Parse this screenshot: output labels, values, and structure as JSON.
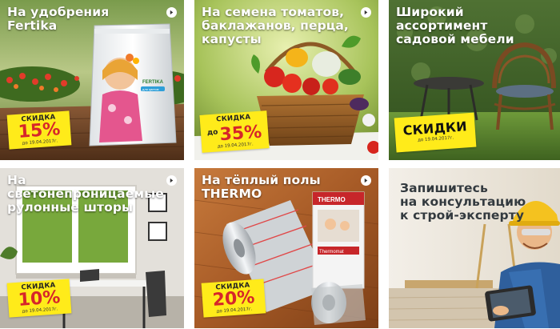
{
  "tiles": [
    {
      "id": "fertilizer",
      "title": "На удобрения\nFertika",
      "product_brand": "FERTIKA",
      "product_text": "для цветов",
      "badge": {
        "label": "СКИДКА",
        "percent": "15%",
        "prefix": "",
        "date": "до 19.04.2017г."
      }
    },
    {
      "id": "seeds",
      "title": "На семена томатов,\nбаклажанов, перца,\nкапусты",
      "badge": {
        "label": "СКИДКА",
        "percent": "35%",
        "prefix": "до",
        "date": "до 19.04.2017г."
      }
    },
    {
      "id": "furniture",
      "title": "Широкий ассортимент\nсадовой мебели",
      "badge": {
        "label": "СКИДКИ",
        "date": "до 19.04.2017г."
      }
    },
    {
      "id": "blinds",
      "title": "На светонепроницаемые\nрулонные шторы",
      "badge": {
        "label": "СКИДКА",
        "percent": "10%",
        "prefix": "",
        "date": "до 19.04.2017г."
      }
    },
    {
      "id": "floor",
      "title": "На тёплый полы\nTHERMO",
      "product_brand": "THERMO",
      "product_text": "Thermomat",
      "badge": {
        "label": "СКИДКА",
        "percent": "20%",
        "prefix": "",
        "date": "до 19.04.2017г."
      }
    },
    {
      "id": "consult",
      "title": "Запишитесь\nна консультацию\nк строй-эксперту"
    }
  ],
  "colors": {
    "badge_bg": "#ffeb1a",
    "badge_text": "#d6262a",
    "title": "#ffffff"
  },
  "icons": {
    "arrow": "chevron-right-icon"
  }
}
